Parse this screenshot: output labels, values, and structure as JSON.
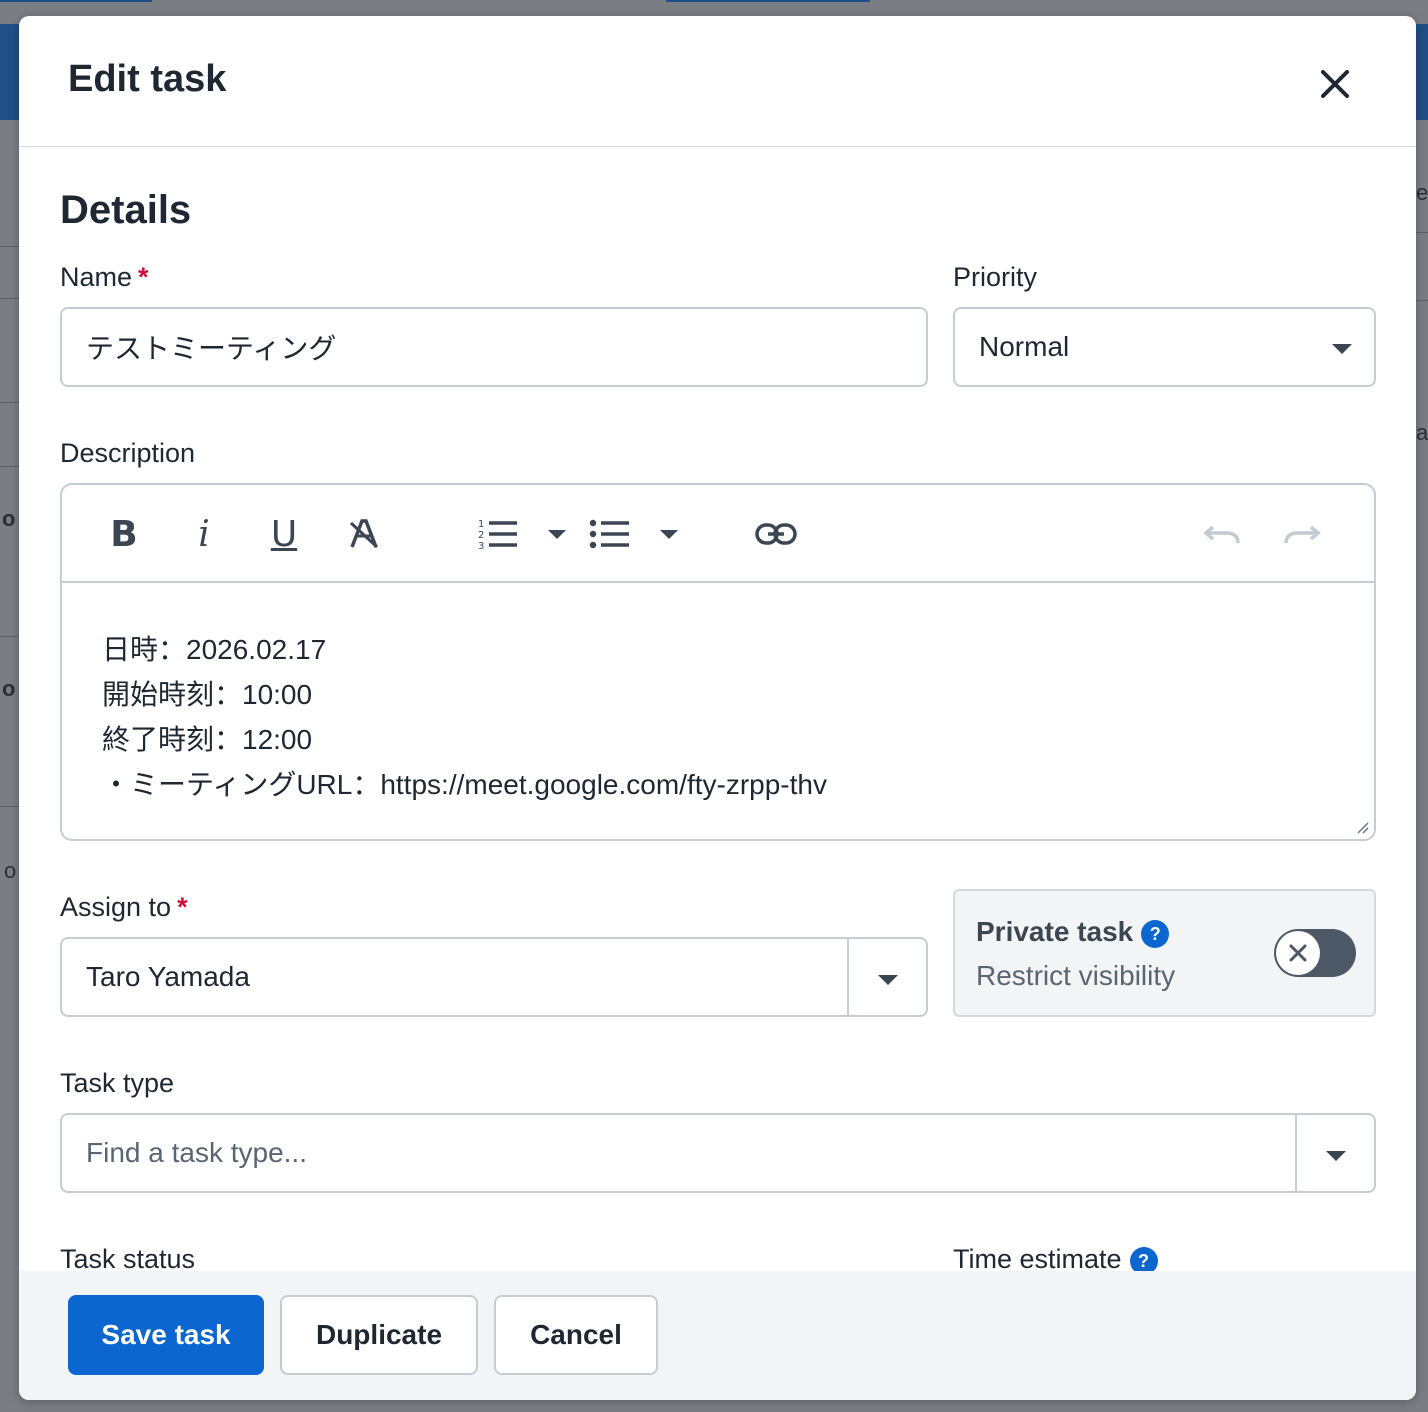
{
  "modal": {
    "title": "Edit task"
  },
  "details": {
    "section_title": "Details",
    "name_label": "Name",
    "name_value": "テストミーティング",
    "required_mark": "*",
    "priority_label": "Priority",
    "priority_value": "Normal",
    "description_label": "Description",
    "description_lines": [
      "日時：2026.02.17",
      "開始時刻：10:00",
      "終了時刻：12:00",
      "・ミーティングURL：https://meet.google.com/fty-zrpp-thv"
    ],
    "assign_label": "Assign to",
    "assign_value": "Taro Yamada",
    "private_task_title": "Private task",
    "private_task_help": "?",
    "private_task_subtitle": "Restrict visibility",
    "private_task_enabled": false,
    "task_type_label": "Task type",
    "task_type_placeholder": "Find a task type...",
    "task_status_label": "Task status",
    "time_estimate_label": "Time estimate",
    "time_estimate_help": "?"
  },
  "toolbar": {
    "bold": "B",
    "italic": "i",
    "underline": "U",
    "items": [
      "bold-icon",
      "italic-icon",
      "underline-icon",
      "clear-format-icon",
      "ordered-list-icon",
      "bullet-list-icon",
      "link-icon",
      "undo-icon",
      "redo-icon"
    ]
  },
  "footer": {
    "save_label": "Save task",
    "duplicate_label": "Duplicate",
    "cancel_label": "Cancel"
  },
  "colors": {
    "primary": "#0b66d0",
    "required": "#d0103a",
    "toggle_off": "#4d5866"
  }
}
